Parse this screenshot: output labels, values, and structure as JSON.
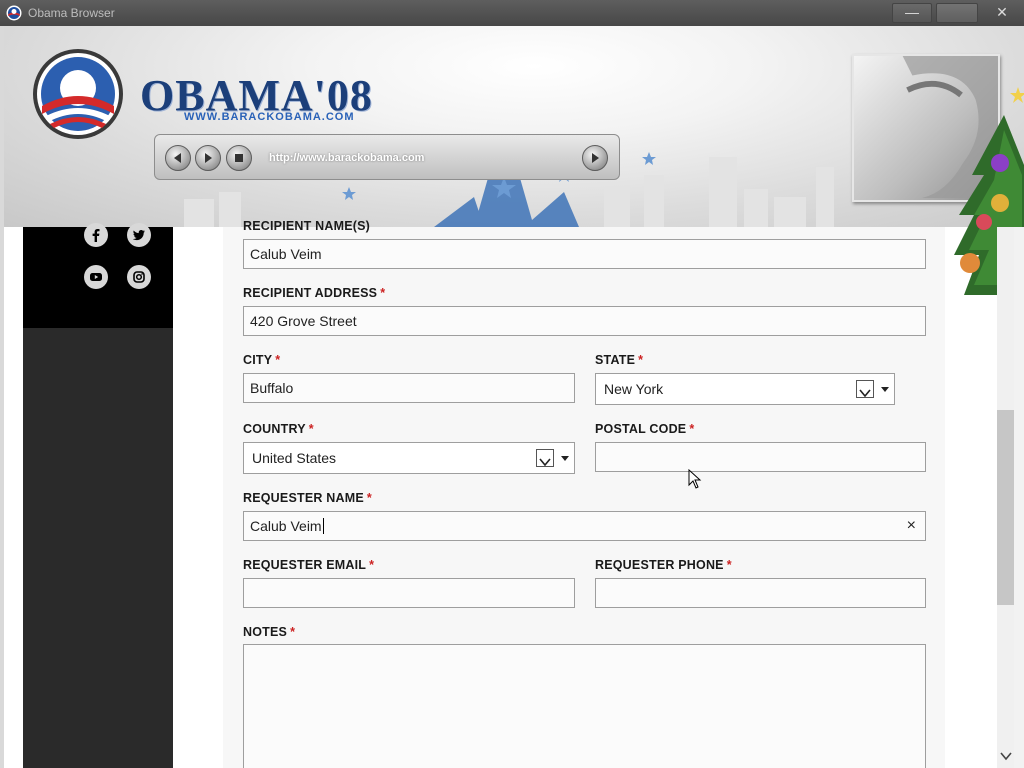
{
  "window": {
    "title": "Obama Browser",
    "minimize_glyph": "—",
    "close_glyph": "✕"
  },
  "banner": {
    "logo_text": "OBAMA'08",
    "logo_subtext": "WWW.BARACKOBAMA.COM",
    "url": "http://www.barackobama.com"
  },
  "social_icons": [
    "facebook-icon",
    "twitter-icon",
    "youtube-icon",
    "instagram-icon"
  ],
  "form": {
    "recipient_name_label": "RECIPIENT NAME(S)",
    "recipient_name_value": "Calub Veim",
    "recipient_address_label": "RECIPIENT ADDRESS",
    "recipient_address_value": "420 Grove Street",
    "city_label": "CITY",
    "city_value": "Buffalo",
    "state_label": "STATE",
    "state_value": "New York",
    "country_label": "COUNTRY",
    "country_value": "United States",
    "postal_code_label": "POSTAL CODE",
    "postal_code_value": "",
    "requester_name_label": "REQUESTER NAME",
    "requester_name_value": "Calub Veim",
    "requester_email_label": "REQUESTER EMAIL",
    "requester_email_value": "",
    "requester_phone_label": "REQUESTER PHONE",
    "requester_phone_value": "",
    "notes_label": "NOTES",
    "notes_value": "",
    "required_marker": "*",
    "clear_glyph": "×"
  },
  "colors": {
    "required": "#cc2222",
    "sidebar_black": "#000000",
    "sidebar_dark": "#2a2a2a",
    "logo_blue": "#1c3f7a"
  }
}
